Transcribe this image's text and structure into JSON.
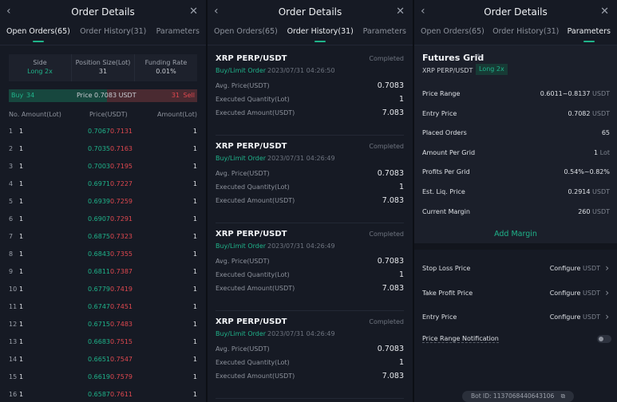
{
  "header": {
    "title": "Order Details",
    "back_icon": "chevron-left",
    "close_icon": "close"
  },
  "tabs": [
    "Open Orders(65)",
    "Order History(31)",
    "Parameters"
  ],
  "open_orders": {
    "summary": [
      {
        "label": "Side",
        "value": "Long 2x"
      },
      {
        "label": "Position Size(Lot)",
        "value": "31"
      },
      {
        "label": "Funding Rate",
        "value": "0.01%"
      }
    ],
    "bar": {
      "buy_label": "Buy",
      "buy_count": "34",
      "price": "Price 0.7083 USDT",
      "sell_count": "31",
      "sell_label": "Sell",
      "buy_fraction": 0.52
    },
    "columns": [
      "No. Amount(Lot)",
      "Price(USDT)",
      "Amount(Lot)"
    ],
    "rows": [
      {
        "no": "1",
        "amt": "1",
        "buy": "0.7067",
        "sell": "0.7131",
        "ramt": "1"
      },
      {
        "no": "2",
        "amt": "1",
        "buy": "0.7035",
        "sell": "0.7163",
        "ramt": "1"
      },
      {
        "no": "3",
        "amt": "1",
        "buy": "0.7003",
        "sell": "0.7195",
        "ramt": "1"
      },
      {
        "no": "4",
        "amt": "1",
        "buy": "0.6971",
        "sell": "0.7227",
        "ramt": "1"
      },
      {
        "no": "5",
        "amt": "1",
        "buy": "0.6939",
        "sell": "0.7259",
        "ramt": "1"
      },
      {
        "no": "6",
        "amt": "1",
        "buy": "0.6907",
        "sell": "0.7291",
        "ramt": "1"
      },
      {
        "no": "7",
        "amt": "1",
        "buy": "0.6875",
        "sell": "0.7323",
        "ramt": "1"
      },
      {
        "no": "8",
        "amt": "1",
        "buy": "0.6843",
        "sell": "0.7355",
        "ramt": "1"
      },
      {
        "no": "9",
        "amt": "1",
        "buy": "0.6811",
        "sell": "0.7387",
        "ramt": "1"
      },
      {
        "no": "10",
        "amt": "1",
        "buy": "0.6779",
        "sell": "0.7419",
        "ramt": "1"
      },
      {
        "no": "11",
        "amt": "1",
        "buy": "0.6747",
        "sell": "0.7451",
        "ramt": "1"
      },
      {
        "no": "12",
        "amt": "1",
        "buy": "0.6715",
        "sell": "0.7483",
        "ramt": "1"
      },
      {
        "no": "13",
        "amt": "1",
        "buy": "0.6683",
        "sell": "0.7515",
        "ramt": "1"
      },
      {
        "no": "14",
        "amt": "1",
        "buy": "0.6651",
        "sell": "0.7547",
        "ramt": "1"
      },
      {
        "no": "15",
        "amt": "1",
        "buy": "0.6619",
        "sell": "0.7579",
        "ramt": "1"
      },
      {
        "no": "16",
        "amt": "1",
        "buy": "0.6587",
        "sell": "0.7611",
        "ramt": "1"
      }
    ]
  },
  "order_history": {
    "entries": [
      {
        "pair": "XRP PERP/USDT",
        "status": "Completed",
        "type": "Buy/Limit Order",
        "time": "2023/07/31 04:26:50",
        "fields": [
          {
            "label": "Avg. Price(USDT)",
            "value": "0.7083"
          },
          {
            "label": "Executed Quantity(Lot)",
            "value": "1"
          },
          {
            "label": "Executed Amount(USDT)",
            "value": "7.083"
          }
        ]
      },
      {
        "pair": "XRP PERP/USDT",
        "status": "Completed",
        "type": "Buy/Limit Order",
        "time": "2023/07/31 04:26:49",
        "fields": [
          {
            "label": "Avg. Price(USDT)",
            "value": "0.7083"
          },
          {
            "label": "Executed Quantity(Lot)",
            "value": "1"
          },
          {
            "label": "Executed Amount(USDT)",
            "value": "7.083"
          }
        ]
      },
      {
        "pair": "XRP PERP/USDT",
        "status": "Completed",
        "type": "Buy/Limit Order",
        "time": "2023/07/31 04:26:49",
        "fields": [
          {
            "label": "Avg. Price(USDT)",
            "value": "0.7083"
          },
          {
            "label": "Executed Quantity(Lot)",
            "value": "1"
          },
          {
            "label": "Executed Amount(USDT)",
            "value": "7.083"
          }
        ]
      },
      {
        "pair": "XRP PERP/USDT",
        "status": "Completed",
        "type": "Buy/Limit Order",
        "time": "2023/07/31 04:26:49",
        "fields": [
          {
            "label": "Avg. Price(USDT)",
            "value": "0.7083"
          },
          {
            "label": "Executed Quantity(Lot)",
            "value": "1"
          },
          {
            "label": "Executed Amount(USDT)",
            "value": "7.083"
          }
        ]
      }
    ]
  },
  "parameters": {
    "title": "Futures Grid",
    "pair": "XRP PERP/USDT",
    "side": "Long 2x",
    "rows": [
      {
        "label": "Price Range",
        "value": "0.6011~0.8137",
        "unit": "USDT"
      },
      {
        "label": "Entry Price",
        "value": "0.7082",
        "unit": "USDT"
      },
      {
        "label": "Placed Orders",
        "value": "65",
        "unit": ""
      },
      {
        "label": "Amount Per Grid",
        "value": "1",
        "unit": "Lot"
      },
      {
        "label": "Profits Per Grid",
        "value": "0.54%~0.82%",
        "unit": ""
      },
      {
        "label": "Est. Liq. Price",
        "value": "0.2914",
        "unit": "USDT"
      },
      {
        "label": "Current Margin",
        "value": "260",
        "unit": "USDT"
      }
    ],
    "add_margin": "Add Margin",
    "configs": [
      {
        "label": "Stop Loss Price",
        "action": "Configure",
        "unit": "USDT"
      },
      {
        "label": "Take Profit Price",
        "action": "Configure",
        "unit": "USDT"
      },
      {
        "label": "Entry Price",
        "action": "Configure",
        "unit": "USDT"
      }
    ],
    "notification": {
      "label": "Price Range Notification",
      "enabled": false
    },
    "bot_id": "Bot ID: 1137068440643106"
  },
  "colors": {
    "green": "#1fb38a",
    "red": "#e0484f",
    "bg": "#161a24"
  }
}
